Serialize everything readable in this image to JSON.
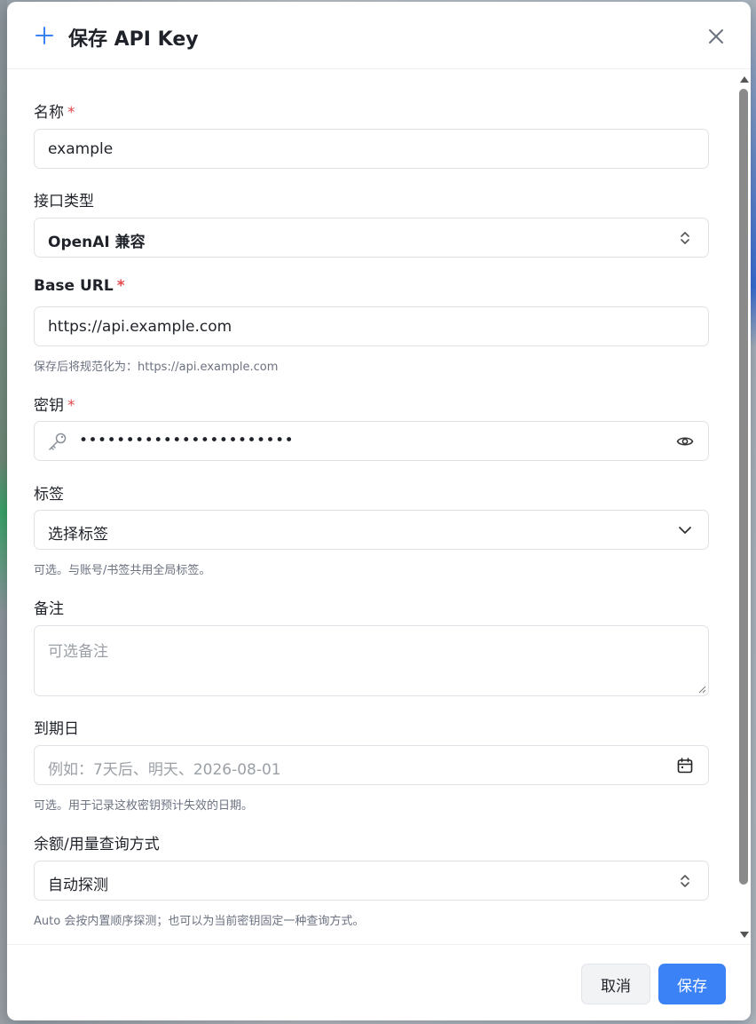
{
  "dialog": {
    "title": "保存 API Key"
  },
  "form": {
    "name": {
      "label": "名称",
      "required": "*",
      "value": "example"
    },
    "api_type": {
      "label": "接口类型",
      "value": "OpenAI 兼容"
    },
    "base_url": {
      "label": "Base URL",
      "required": "*",
      "value": "https://api.example.com",
      "hint": "保存后将规范化为：https://api.example.com"
    },
    "secret": {
      "label": "密钥",
      "required": "*",
      "value": "•••••••••••••••••••••••"
    },
    "tags": {
      "label": "标签",
      "placeholder": "选择标签",
      "hint": "可选。与账号/书签共用全局标签。"
    },
    "notes": {
      "label": "备注",
      "placeholder": "可选备注"
    },
    "expiry": {
      "label": "到期日",
      "placeholder": "例如：7天后、明天、2026-08-01",
      "hint": "可选。用于记录这枚密钥预计失效的日期。"
    },
    "quota": {
      "label": "余额/用量查询方式",
      "value": "自动探测",
      "hint": "Auto 会按内置顺序探测；也可以为当前密钥固定一种查询方式。"
    }
  },
  "footer": {
    "cancel_label": "取消",
    "save_label": "保存"
  },
  "colors": {
    "accent": "#3b82f6",
    "required": "#e5484d"
  },
  "icons": [
    "plus-icon",
    "close-icon",
    "select-arrows-icon",
    "key-icon",
    "eye-icon",
    "chevron-down-icon",
    "calendar-icon"
  ]
}
